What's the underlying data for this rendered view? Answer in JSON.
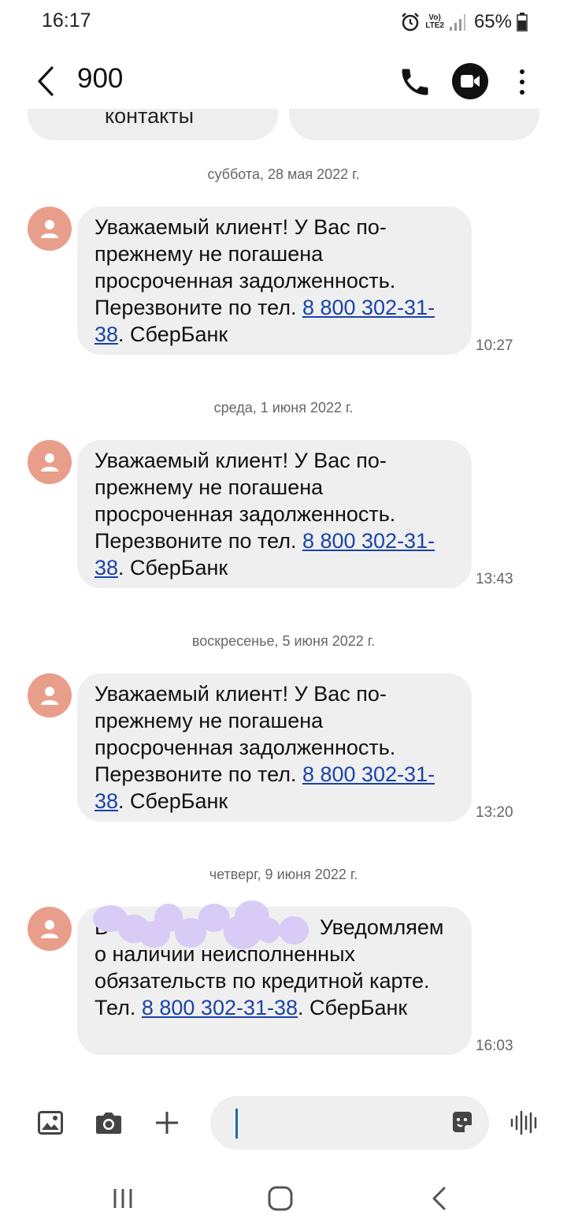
{
  "status_bar": {
    "time": "16:17",
    "network_label": "Vo)) LTE2",
    "battery": "65%",
    "icons": [
      "alarm-icon",
      "volte-icon",
      "signal-icon",
      "battery-icon"
    ]
  },
  "header": {
    "title": "900",
    "back_icon": "chevron-left-icon",
    "call_icon": "phone-icon",
    "video_icon": "video-call-icon",
    "more_icon": "more-vertical-icon"
  },
  "chips": {
    "left_label": "контакты",
    "right_label": ""
  },
  "messages": [
    {
      "date": "суббота, 28 мая 2022 г.",
      "text_before": "Уважаемый клиент! У Вас по-прежнему не погашена просроченная задолженность. Перезвоните по тел. ",
      "phone": "8 800 302-31-38",
      "text_after": ". СберБанк",
      "time": "10:27"
    },
    {
      "date": "среда, 1 июня 2022 г.",
      "text_before": "Уважаемый клиент! У Вас по-прежнему не погашена просроченная задолженность. Перезвоните по тел. ",
      "phone": "8 800 302-31-38",
      "text_after": ". СберБанк",
      "time": "13:43"
    },
    {
      "date": "воскресенье, 5 июня 2022 г.",
      "text_before": "Уважаемый клиент! У Вас по-прежнему не погашена просроченная задолженность. Перезвоните по тел. ",
      "phone": "8 800 302-31-38",
      "text_after": ". СберБанк",
      "time": "13:20"
    },
    {
      "date": "четверг, 9 июня 2022 г.",
      "text_visible_start": "В",
      "text_before": "Уведомляем о наличии неисполненных обязательств по кредитной карте. Тел. ",
      "phone": "8 800 302-31-38",
      "text_after": ". СберБанк",
      "time": "16:03"
    }
  ],
  "compose": {
    "placeholder": "",
    "tools": [
      "gallery-icon",
      "camera-icon",
      "plus-icon"
    ],
    "sticker_icon": "sticker-icon",
    "voice_icon": "voice-record-icon"
  },
  "navigation": {
    "buttons": [
      "recent-apps-icon",
      "home-icon",
      "back-icon"
    ]
  },
  "colors": {
    "bubble": "#efefef",
    "avatar": "#e89e8b",
    "link": "#1a43a8",
    "accent": "#1a6f9f"
  }
}
